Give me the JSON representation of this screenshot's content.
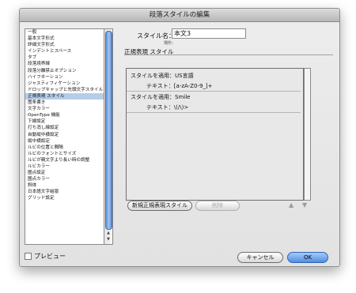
{
  "window": {
    "title": "段落スタイルの編集"
  },
  "sidebar": {
    "items": [
      {
        "label": "一般"
      },
      {
        "label": "基本文字形式"
      },
      {
        "label": "詳細文字形式"
      },
      {
        "label": "インデントとスペース"
      },
      {
        "label": "タブ"
      },
      {
        "label": "段落境界線"
      },
      {
        "label": "段落分離禁止オプション"
      },
      {
        "label": "ハイフネーション"
      },
      {
        "label": "ジャスティフィケーション"
      },
      {
        "label": "ドロップキャップと先頭文字スタイル"
      },
      {
        "label": "正規表現 スタイル",
        "selected": true
      },
      {
        "label": "箇条書き"
      },
      {
        "label": "文字カラー"
      },
      {
        "label": "OpenType 機能"
      },
      {
        "label": "下線設定"
      },
      {
        "label": "打ち消し線設定"
      },
      {
        "label": "自動縦中横設定"
      },
      {
        "label": "縦中横設定"
      },
      {
        "label": "ルビの位置と間隔"
      },
      {
        "label": "ルビのフォントとサイズ"
      },
      {
        "label": "ルビが親文字より長い時の調整"
      },
      {
        "label": "ルビカラー"
      },
      {
        "label": "圏点設定"
      },
      {
        "label": "圏点カラー"
      },
      {
        "label": "斜体"
      },
      {
        "label": "日本語文字組版"
      },
      {
        "label": "グリッド設定"
      }
    ]
  },
  "form": {
    "style_name_label": "スタイル名：",
    "style_name_value": "本文3",
    "location_label": "場所：",
    "section_title": "正規表現 スタイル"
  },
  "rules": [
    {
      "apply_label": "スタイルを適用：",
      "apply_value": "US言語",
      "text_label": "テキスト：",
      "text_value": "[a-zA-Z0-9_]+"
    },
    {
      "apply_label": "スタイルを適用：",
      "apply_value": "Smile",
      "text_label": "テキスト：",
      "text_value": "\\(/\\)>"
    }
  ],
  "buttons": {
    "new_rule": "新規正規表現スタイル",
    "delete": "削除",
    "up_arrow": "▲",
    "down_arrow": "▼",
    "cancel": "キャンセル",
    "ok": "OK"
  },
  "footer": {
    "preview_label": "プレビュー"
  }
}
